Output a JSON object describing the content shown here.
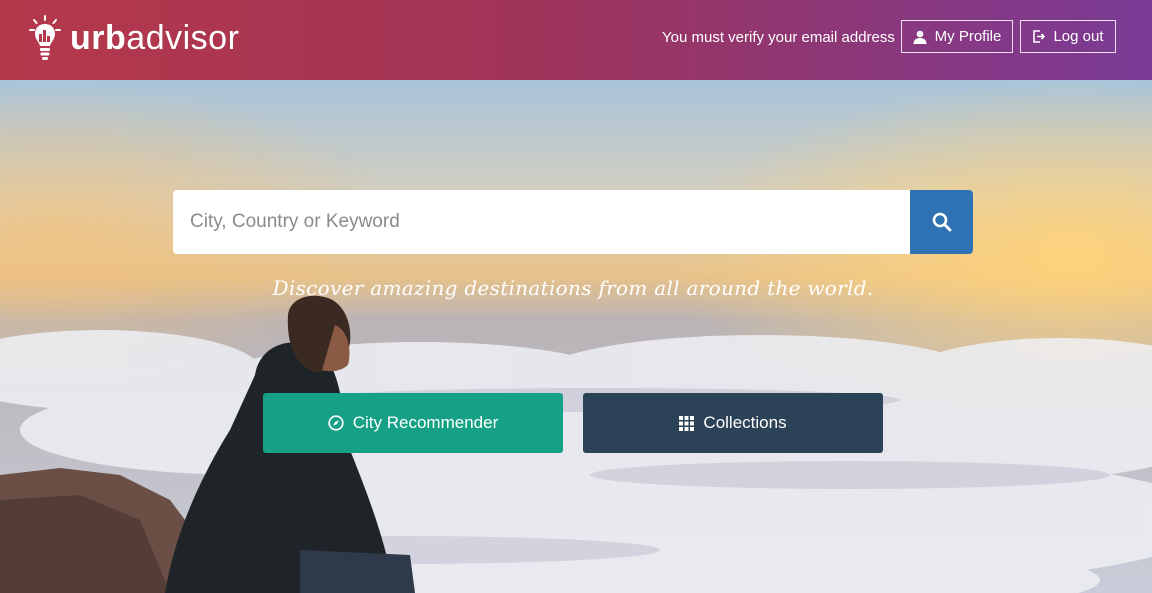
{
  "header": {
    "logo": {
      "prefix": "urb",
      "suffix": "advisor"
    },
    "verify_notice": "You must verify your email address",
    "profile_label": "My Profile",
    "logout_label": "Log out"
  },
  "search": {
    "placeholder": "City, Country or Keyword"
  },
  "hero": {
    "tagline": "Discover amazing destinations from all around the world."
  },
  "actions": {
    "city_recommender_label": "City Recommender",
    "collections_label": "Collections"
  },
  "colors": {
    "header_gradient": [
      "#b5384a",
      "#7a3a96"
    ],
    "search_button": "#2f73b4",
    "city_recommender": "#16a085",
    "collections": "#2c4257"
  },
  "icons": [
    "bulb-logo-icon",
    "user-icon",
    "logout-icon",
    "search-icon",
    "compass-icon",
    "grid-icon"
  ]
}
